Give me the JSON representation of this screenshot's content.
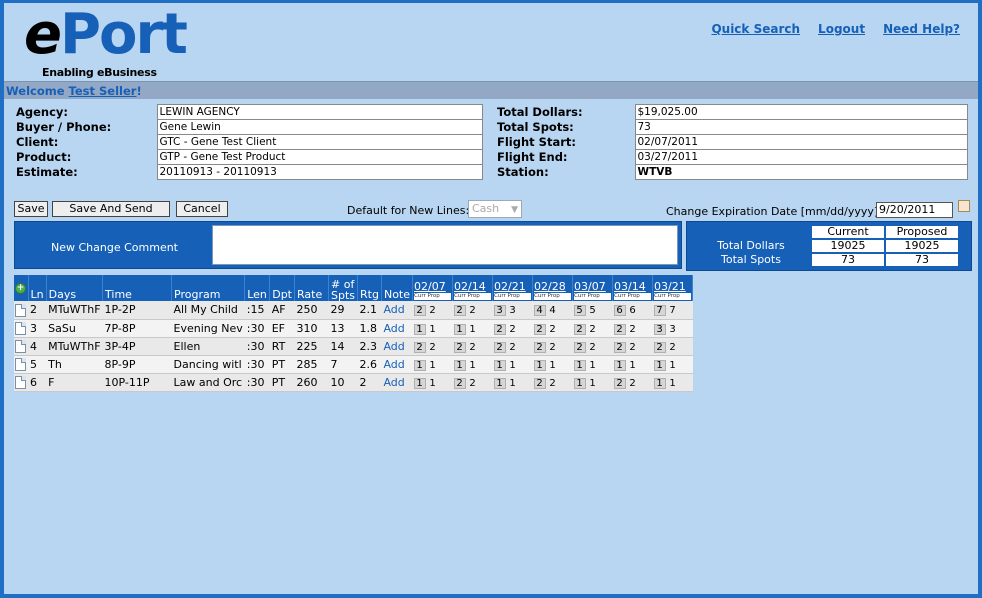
{
  "brand": {
    "logo_e": "e",
    "logo_rest": "Port",
    "tagline": "Enabling eBusiness"
  },
  "top_links": [
    "Quick Search",
    "Logout",
    "Need Help?"
  ],
  "welcome": {
    "prefix": "Welcome ",
    "user": "Test Seller",
    "suffix": "!"
  },
  "info_left": [
    {
      "label": "Agency:",
      "value": "LEWIN AGENCY"
    },
    {
      "label": "Buyer / Phone:",
      "value": "Gene Lewin"
    },
    {
      "label": "Client:",
      "value": "GTC - Gene Test Client"
    },
    {
      "label": "Product:",
      "value": "GTP - Gene Test Product"
    },
    {
      "label": "Estimate:",
      "value": "20110913 - 20110913"
    }
  ],
  "info_right": [
    {
      "label": "Total Dollars:",
      "value": "$19,025.00"
    },
    {
      "label": "Total Spots:",
      "value": "73"
    },
    {
      "label": "Flight Start:",
      "value": "02/07/2011"
    },
    {
      "label": "Flight End:",
      "value": "03/27/2011"
    },
    {
      "label": "Station:",
      "value": "WTVB"
    }
  ],
  "buttons": {
    "save": "Save",
    "save_send": "Save And Send",
    "cancel": "Cancel"
  },
  "default_lines": {
    "label": "Default for New Lines:",
    "value": "Cash"
  },
  "expiration": {
    "label": "Change Expiration Date [mm/dd/yyyy]:",
    "value": "9/20/2011"
  },
  "comment": {
    "label": "New Change Comment",
    "value": ""
  },
  "totals": {
    "current_header": "Current",
    "proposed_header": "Proposed",
    "rows": [
      {
        "label": "Total Dollars",
        "current": "19025",
        "proposed": "19025"
      },
      {
        "label": "Total Spots",
        "current": "73",
        "proposed": "73"
      }
    ]
  },
  "grid": {
    "headers": {
      "ln": "Ln",
      "days": "Days",
      "time": "Time",
      "program": "Program",
      "len": "Len",
      "dpt": "Dpt",
      "rate": "Rate",
      "spots_1": "# of",
      "spots_2": "Spts",
      "rtg": "Rtg",
      "note": "Note"
    },
    "week_sub": "Curr Prop",
    "weeks": [
      "02/07",
      "02/14",
      "02/21",
      "02/28",
      "03/07",
      "03/14",
      "03/21"
    ],
    "rows": [
      {
        "ln": "2",
        "days": "MTuWThF",
        "time": "1P-2P",
        "program": "All My Child",
        "len": ":15",
        "dpt": "AF",
        "rate": "250",
        "spots": "29",
        "rtg": "2.1",
        "note": "Add",
        "weeks": [
          [
            "2",
            "2"
          ],
          [
            "2",
            "2"
          ],
          [
            "3",
            "3"
          ],
          [
            "4",
            "4"
          ],
          [
            "5",
            "5"
          ],
          [
            "6",
            "6"
          ],
          [
            "7",
            "7"
          ]
        ]
      },
      {
        "ln": "3",
        "days": "SaSu",
        "time": "7P-8P",
        "program": "Evening Nev",
        "len": ":30",
        "dpt": "EF",
        "rate": "310",
        "spots": "13",
        "rtg": "1.8",
        "note": "Add",
        "weeks": [
          [
            "1",
            "1"
          ],
          [
            "1",
            "1"
          ],
          [
            "2",
            "2"
          ],
          [
            "2",
            "2"
          ],
          [
            "2",
            "2"
          ],
          [
            "2",
            "2"
          ],
          [
            "3",
            "3"
          ]
        ]
      },
      {
        "ln": "4",
        "days": "MTuWThF",
        "time": "3P-4P",
        "program": "Ellen",
        "len": ":30",
        "dpt": "RT",
        "rate": "225",
        "spots": "14",
        "rtg": "2.3",
        "note": "Add",
        "weeks": [
          [
            "2",
            "2"
          ],
          [
            "2",
            "2"
          ],
          [
            "2",
            "2"
          ],
          [
            "2",
            "2"
          ],
          [
            "2",
            "2"
          ],
          [
            "2",
            "2"
          ],
          [
            "2",
            "2"
          ]
        ]
      },
      {
        "ln": "5",
        "days": "Th",
        "time": "8P-9P",
        "program": "Dancing witl",
        "len": ":30",
        "dpt": "PT",
        "rate": "285",
        "spots": "7",
        "rtg": "2.6",
        "note": "Add",
        "weeks": [
          [
            "1",
            "1"
          ],
          [
            "1",
            "1"
          ],
          [
            "1",
            "1"
          ],
          [
            "1",
            "1"
          ],
          [
            "1",
            "1"
          ],
          [
            "1",
            "1"
          ],
          [
            "1",
            "1"
          ]
        ]
      },
      {
        "ln": "6",
        "days": "F",
        "time": "10P-11P",
        "program": "Law and Orc",
        "len": ":30",
        "dpt": "PT",
        "rate": "260",
        "spots": "10",
        "rtg": "2",
        "note": "Add",
        "weeks": [
          [
            "1",
            "1"
          ],
          [
            "2",
            "2"
          ],
          [
            "1",
            "1"
          ],
          [
            "2",
            "2"
          ],
          [
            "1",
            "1"
          ],
          [
            "2",
            "2"
          ],
          [
            "1",
            "1"
          ]
        ]
      }
    ]
  }
}
